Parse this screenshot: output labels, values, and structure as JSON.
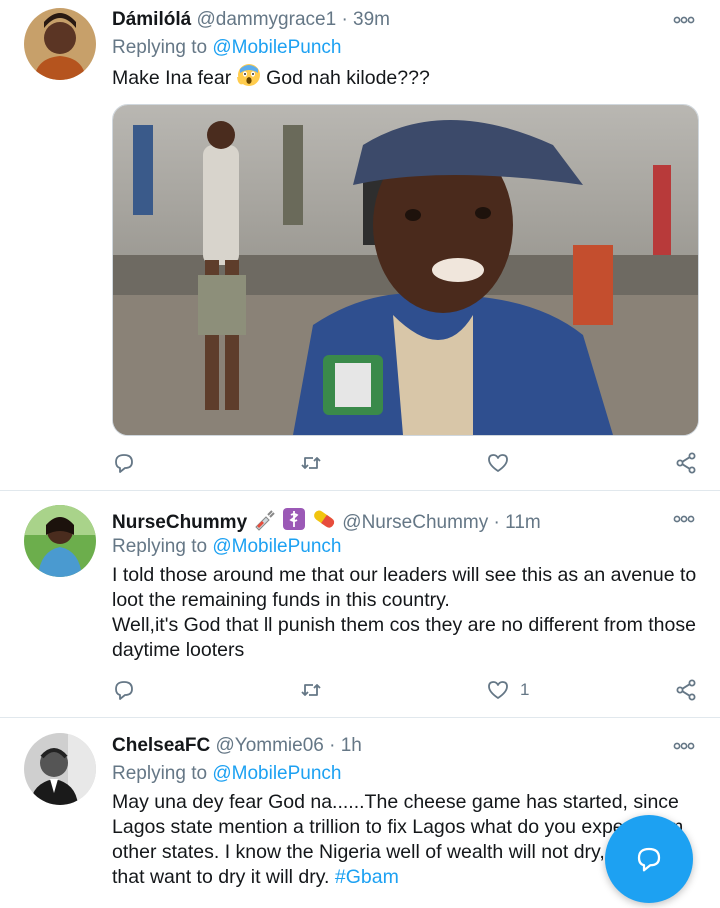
{
  "tweets": [
    {
      "name": "Dámilólá",
      "handle": "@dammygrace1",
      "separator": "·",
      "time": "39m",
      "reply_prefix": "Replying to",
      "reply_to": "@MobilePunch",
      "text_before": "Make Ina fear",
      "text_after": "God nah kilode???",
      "media_icon": "photo-police-uniform",
      "like_count": ""
    },
    {
      "name": "NurseChummy",
      "handle": "@NurseChummy",
      "separator": "·",
      "time": "11m",
      "reply_prefix": "Replying to",
      "reply_to": "@MobilePunch",
      "text_line1": "I told those around me that our leaders will see this as an avenue to loot the remaining funds in this country.",
      "text_line2": "Well,it's God that ll punish them cos they are no different from those daytime looters",
      "like_count": "1"
    },
    {
      "name": "ChelseaFC",
      "handle": "@Yommie06",
      "separator": "·",
      "time": "1h",
      "reply_prefix": "Replying to",
      "reply_to": "@MobilePunch",
      "text": "May una dey fear God na......The cheese game has started, since Lagos state mention a trillion to fix Lagos what do you expect from other states. I know the Nigeria well of wealth will not dry, people that want to dry it will dry.",
      "hashtag": "#Gbam",
      "like_count": ""
    }
  ],
  "colors": {
    "accent": "#1da1f2",
    "secondary": "#657786",
    "divider": "#e1e8ed"
  },
  "fab": {
    "icon": "chat-bubble-icon"
  }
}
